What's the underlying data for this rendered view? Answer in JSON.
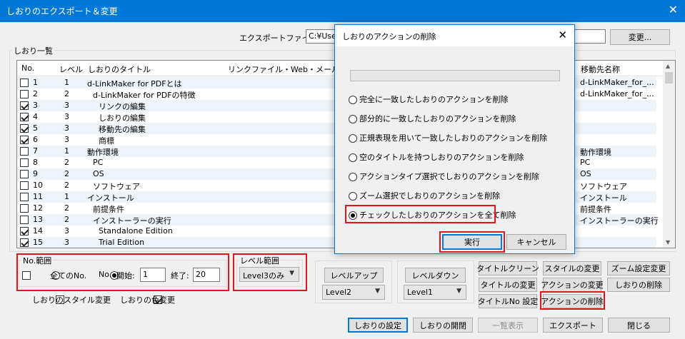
{
  "window": {
    "title": "しおりのエクスポート＆変更",
    "close": "✕"
  },
  "export": {
    "label": "エクスポートファイル:",
    "path": "C:¥Use",
    "change_button": "変更..."
  },
  "bookmarks": {
    "group_label": "しおり一覧",
    "columns": [
      "No.",
      "レベル",
      "しおりのタイトル",
      "リンクファイル・Web・メール",
      "移動先名称"
    ],
    "rows": [
      {
        "checked": false,
        "no": "1",
        "level": "1",
        "title": "d-LinkMaker for PDFとは",
        "dest": "d-LinkMaker_for_..."
      },
      {
        "checked": false,
        "no": "2",
        "level": "2",
        "title": "d-LinkMaker for PDFの特徴",
        "dest": "d-LinkMaker_for_..."
      },
      {
        "checked": true,
        "no": "3",
        "level": "3",
        "title": "リンクの編集",
        "dest": ""
      },
      {
        "checked": true,
        "no": "4",
        "level": "3",
        "title": "しおりの編集",
        "dest": ""
      },
      {
        "checked": true,
        "no": "5",
        "level": "3",
        "title": "移動先の編集",
        "dest": ""
      },
      {
        "checked": true,
        "no": "6",
        "level": "3",
        "title": "商標",
        "dest": ""
      },
      {
        "checked": false,
        "no": "7",
        "level": "1",
        "title": "動作環境",
        "dest": "動作環境"
      },
      {
        "checked": false,
        "no": "8",
        "level": "2",
        "title": "PC",
        "dest": "PC"
      },
      {
        "checked": false,
        "no": "9",
        "level": "2",
        "title": "OS",
        "dest": "OS"
      },
      {
        "checked": false,
        "no": "10",
        "level": "2",
        "title": "ソフトウェア",
        "dest": "ソフトウェア"
      },
      {
        "checked": false,
        "no": "11",
        "level": "1",
        "title": "インストール",
        "dest": "インストール"
      },
      {
        "checked": false,
        "no": "12",
        "level": "2",
        "title": "前提条件",
        "dest": "前提条件"
      },
      {
        "checked": false,
        "no": "13",
        "level": "2",
        "title": "インストーラーの実行",
        "dest": "インストーラーの実行"
      },
      {
        "checked": true,
        "no": "14",
        "level": "3",
        "title": "Standalone Edition",
        "dest": ""
      },
      {
        "checked": true,
        "no": "15",
        "level": "3",
        "title": "Trial Edition",
        "dest": ""
      }
    ]
  },
  "range": {
    "label": "No.範囲",
    "all_label": "全てのNo.",
    "no_label": "No.",
    "start_label": "開始:",
    "start_value": "1",
    "end_label": "終了:",
    "end_value": "20"
  },
  "level_range": {
    "label": "レベル範囲",
    "value": "Level3のみ"
  },
  "style_change": {
    "label": "しおりのスタイル変更",
    "checked": false
  },
  "color_change": {
    "label": "しおりの色変更",
    "checked": true
  },
  "level_up": {
    "button": "レベルアップ",
    "value": "Level2"
  },
  "level_down": {
    "button": "レベルダウン",
    "value": "Level1"
  },
  "actions": {
    "title_clean": "タイトルクリーン",
    "style_change": "スタイルの変更",
    "zoom_change": "ズーム設定変更",
    "title_change": "タイトルの変更",
    "action_change": "アクションの変更",
    "delete_bookmark": "しおりの削除",
    "title_no": "タイトルNo 設定",
    "delete_action": "アクションの削除"
  },
  "footer": {
    "set": "しおりの設定",
    "open_close": "しおりの開閉",
    "list_view": "一覧表示",
    "export": "エクスポート",
    "close": "閉じる"
  },
  "dialog": {
    "title": "しおりのアクションの削除",
    "close": "✕",
    "progress": 0,
    "options": [
      "完全に一致したしおりのアクションを削除",
      "部分的に一致したしおりのアクションを削除",
      "正規表現を用いて一致したしおりのアクションを削除",
      "空のタイトルを持つしおりのアクションを削除",
      "アクションタイプ選択でしおりのアクションを削除",
      "ズーム選択でしおりのアクションを削除",
      "チェックしたしおりのアクションを全て削除"
    ],
    "selected": 6,
    "ok": "実行",
    "cancel": "キャンセル"
  },
  "colors": {
    "accent": "#0078d7",
    "highlight": "#e0161e"
  }
}
